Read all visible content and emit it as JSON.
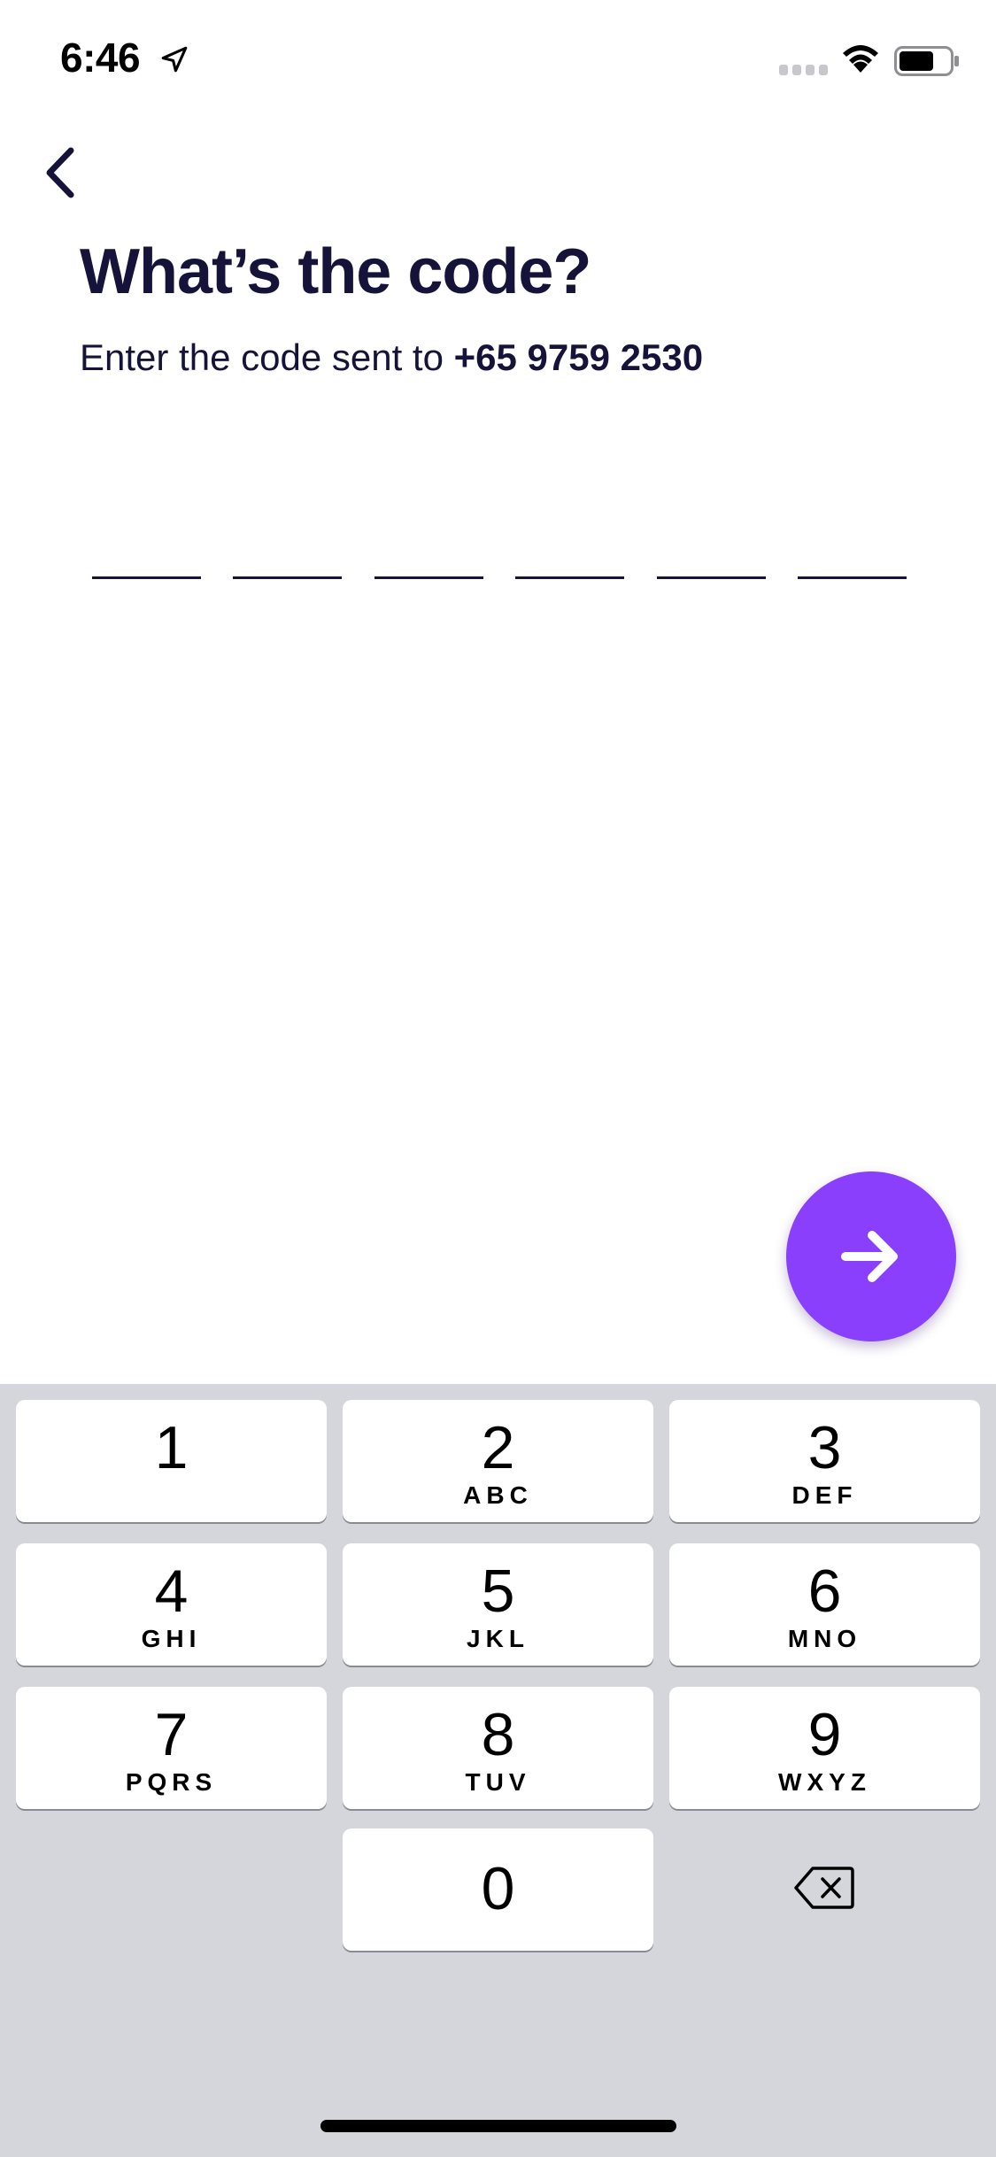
{
  "status_bar": {
    "time": "6:46",
    "location_icon": "location-arrow-icon",
    "signal_icon": "cellular-signal-icon",
    "wifi_icon": "wifi-icon",
    "battery_icon": "battery-icon"
  },
  "header": {
    "back_icon": "chevron-left-icon",
    "title": "What’s the code?",
    "subtitle_prefix": "Enter the code sent to ",
    "phone_number": "+65 9759 2530"
  },
  "code_input": {
    "slots": [
      "",
      "",
      "",
      "",
      "",
      ""
    ]
  },
  "next_button": {
    "icon": "arrow-right-icon",
    "color": "#8a3ffc"
  },
  "keyboard": {
    "keys": [
      {
        "digit": "1",
        "letters": ""
      },
      {
        "digit": "2",
        "letters": "ABC"
      },
      {
        "digit": "3",
        "letters": "DEF"
      },
      {
        "digit": "4",
        "letters": "GHI"
      },
      {
        "digit": "5",
        "letters": "JKL"
      },
      {
        "digit": "6",
        "letters": "MNO"
      },
      {
        "digit": "7",
        "letters": "PQRS"
      },
      {
        "digit": "8",
        "letters": "TUV"
      },
      {
        "digit": "9",
        "letters": "WXYZ"
      },
      {
        "digit": "0",
        "letters": ""
      }
    ],
    "delete_icon": "backspace-icon"
  },
  "colors": {
    "text_primary": "#15133a",
    "accent": "#8a3ffc",
    "keyboard_bg": "#d4d6dc"
  }
}
